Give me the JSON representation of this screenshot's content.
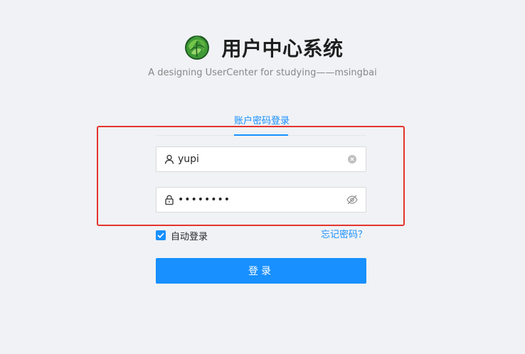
{
  "app": {
    "title": "用户中心系统",
    "subtitle": "A designing UserCenter for studying——msingbai",
    "logo_icon": "cabbage-logo-icon"
  },
  "tabs": [
    {
      "label": "账户密码登录",
      "active": true
    }
  ],
  "form": {
    "username": {
      "value": "yupi",
      "prefix_icon": "user-icon",
      "suffix_icon": "clear-icon"
    },
    "password": {
      "value": "••••••••",
      "prefix_icon": "lock-icon",
      "suffix_icon": "eye-invisible-icon"
    },
    "remember": {
      "label": "自动登录",
      "checked": true
    },
    "forgot_label": "忘记密码？",
    "submit_label": "登录"
  },
  "colors": {
    "primary": "#1890ff",
    "background": "#f0f2f5",
    "highlight": "#e4342e"
  }
}
